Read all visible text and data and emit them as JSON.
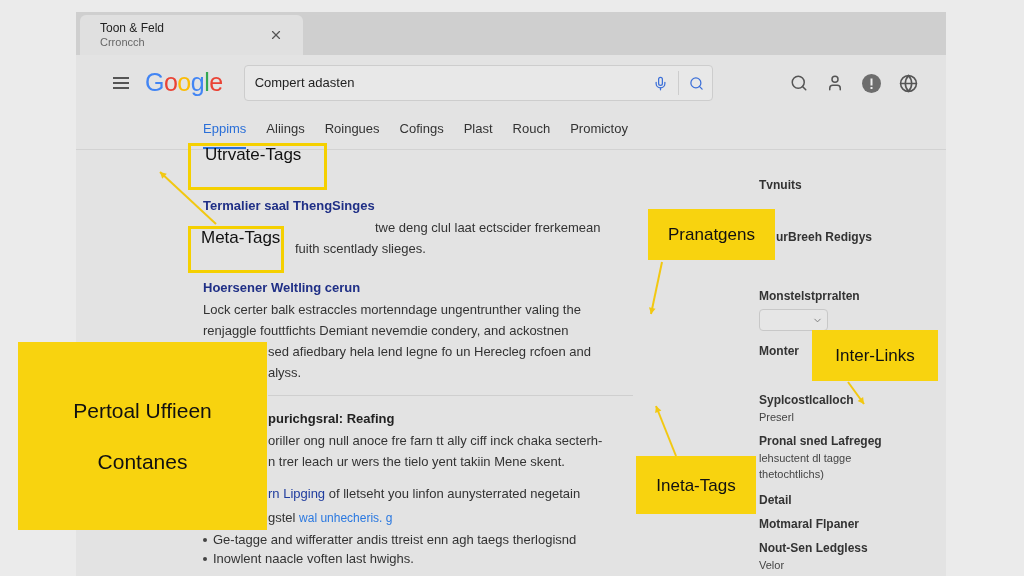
{
  "browser_tab": {
    "title": "Toon & Feld",
    "subtitle": "Crroncch"
  },
  "header": {
    "logo": "Google",
    "search": {
      "value": "Compert adasten"
    }
  },
  "nav_tabs": [
    {
      "label": "Eppims",
      "selected": true
    },
    {
      "label": "Aliings",
      "selected": false
    },
    {
      "label": "Roingues",
      "selected": false
    },
    {
      "label": "Cofings",
      "selected": false
    },
    {
      "label": "Plast",
      "selected": false
    },
    {
      "label": "Rouch",
      "selected": false
    },
    {
      "label": "Promictoy",
      "selected": false
    }
  ],
  "results": [
    {
      "kind": "title",
      "text": "Termalier saal ThengSinges"
    },
    {
      "kind": "text_after_box",
      "text": "twe deng clul laat ectscider frerkemean"
    },
    {
      "kind": "text_after_tag",
      "text": "fuith scentlady slieges."
    },
    {
      "kind": "title",
      "text": "Hoersener Weltling cerun"
    },
    {
      "kind": "text",
      "text": "Lock certer balk estraccles mortenndage ungentrunther valing the"
    },
    {
      "kind": "text",
      "text": "renjaggle fouttfichts Demiant nevemdie condery, and ackostnen"
    },
    {
      "kind": "text_cut",
      "text": "sed afiedbary hela lend legne fo un Herecleg rcfoen and"
    },
    {
      "kind": "text_cut",
      "text": "alyss."
    },
    {
      "kind": "divider"
    },
    {
      "kind": "heading_cut",
      "text": "purichgsral: Reafing"
    },
    {
      "kind": "text_cut",
      "text": "oriller ong null anoce fre farn tt ally ciff inck chaka secterh-"
    },
    {
      "kind": "text_cut",
      "text": "n trer leach ur wers the tielo yent takiin Mene skent."
    },
    {
      "kind": "mixed_cut",
      "parts": [
        {
          "kind": "link",
          "text": "rn Lipging"
        },
        {
          "kind": "plain",
          "text": " of lletseht you linfon aunysterrated negetain"
        }
      ]
    },
    {
      "kind": "mixed_cut",
      "parts": [
        {
          "kind": "plain",
          "text": "gstel "
        },
        {
          "kind": "url",
          "text": "wal unhecheris. g"
        }
      ]
    },
    {
      "kind": "bullet",
      "text": "Ge-tagge and wifferatter andis ttreist enn agh taegs therlogisnd"
    },
    {
      "kind": "bullet",
      "text": "Inowlent naacle voften last hwighs."
    }
  ],
  "sidebar": [
    [
      {
        "kind": "heading",
        "text": "Tvnuits"
      }
    ],
    [
      {
        "kind": "heading_cut",
        "text": "urBreeh Redigys"
      }
    ],
    [
      {
        "kind": "heading",
        "text": "Monstelstprralten"
      },
      {
        "kind": "select"
      }
    ],
    [
      {
        "kind": "heading",
        "text": "Monter"
      }
    ],
    [
      {
        "kind": "heading",
        "text": "Syplcostlcalloch"
      },
      {
        "kind": "sub",
        "text": "Preserl"
      }
    ],
    [
      {
        "kind": "heading",
        "text": "Pronal sned Lafregeg"
      },
      {
        "kind": "sub",
        "text": "lehsuctent dl tagge"
      },
      {
        "kind": "sub",
        "text": "thetochtlichs)"
      }
    ],
    [
      {
        "kind": "heading",
        "text": "Detail"
      }
    ],
    [
      {
        "kind": "heading",
        "text": "Motmaral Flpaner"
      }
    ],
    [
      {
        "kind": "heading",
        "text": "Nout-Sen Ledgless"
      },
      {
        "kind": "sub",
        "text": "Velor"
      }
    ]
  ],
  "callouts": [
    {
      "kind": "outline",
      "lines": [
        "Utrvate-Tags"
      ]
    },
    {
      "kind": "outline",
      "lines": [
        "Meta-Tags"
      ]
    },
    {
      "kind": "filled",
      "lines": [
        "Pranatgens"
      ]
    },
    {
      "kind": "filled",
      "lines": [
        "Inter-Links"
      ]
    },
    {
      "kind": "filled",
      "lines": [
        "Ineta-Tags"
      ]
    },
    {
      "kind": "filled",
      "lines": [
        "Pertoal Uffieen",
        "Contanes"
      ]
    }
  ]
}
